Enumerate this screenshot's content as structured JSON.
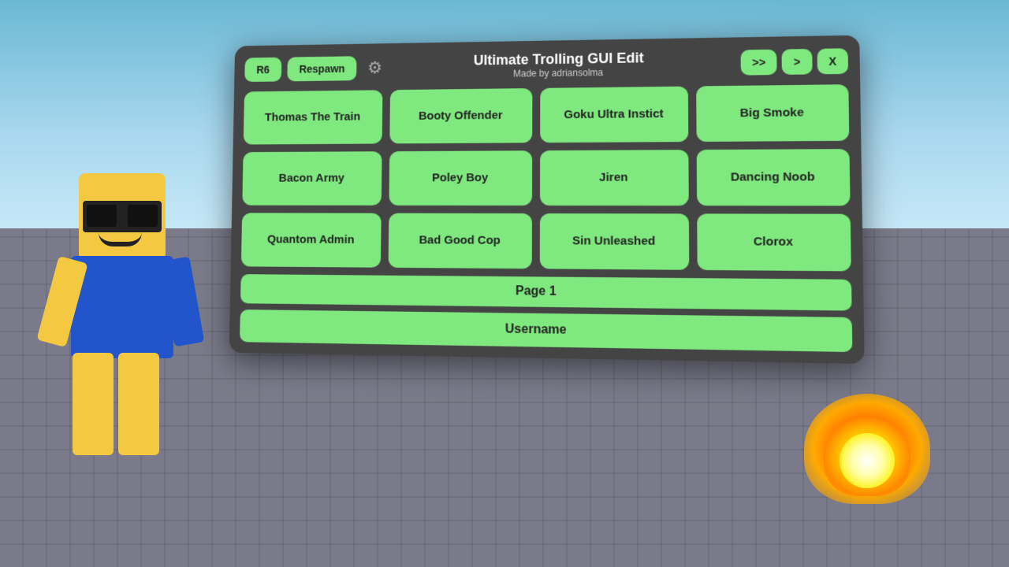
{
  "background": {
    "sky_color": "#87CEEB",
    "ground_color": "#7A7A8A"
  },
  "gui": {
    "title": "Ultimate Trolling GUI Edit",
    "subtitle": "Made by adriansolma",
    "buttons": {
      "r6": "R6",
      "respawn": "Respawn",
      "nav_double": ">>",
      "nav_single": ">",
      "close": "X"
    },
    "troll_buttons": [
      "Thomas The Train",
      "Booty Offender",
      "Goku Ultra Instict",
      "Big Smoke",
      "Bacon Army",
      "Poley Boy",
      "Jiren",
      "Dancing Noob",
      "Quantom Admin",
      "Bad Good Cop",
      "Sin Unleashed",
      "Clorox"
    ],
    "page_label": "Page 1",
    "username_label": "Username"
  }
}
